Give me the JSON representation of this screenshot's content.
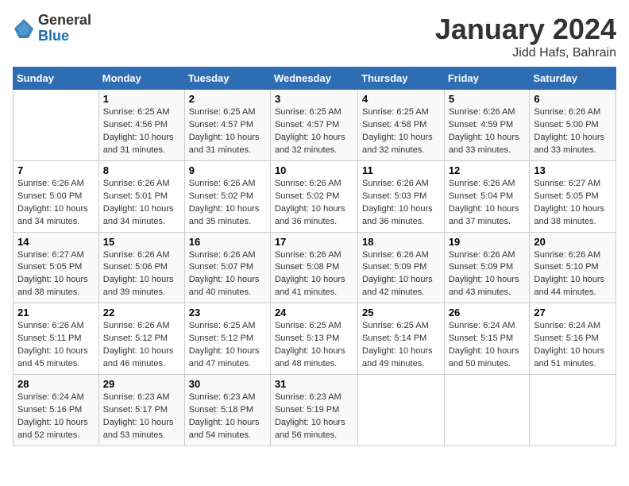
{
  "header": {
    "logo_general": "General",
    "logo_blue": "Blue",
    "title": "January 2024",
    "subtitle": "Jidd Hafs, Bahrain"
  },
  "days_of_week": [
    "Sunday",
    "Monday",
    "Tuesday",
    "Wednesday",
    "Thursday",
    "Friday",
    "Saturday"
  ],
  "weeks": [
    [
      {
        "num": "",
        "info": ""
      },
      {
        "num": "1",
        "info": "Sunrise: 6:25 AM\nSunset: 4:56 PM\nDaylight: 10 hours\nand 31 minutes."
      },
      {
        "num": "2",
        "info": "Sunrise: 6:25 AM\nSunset: 4:57 PM\nDaylight: 10 hours\nand 31 minutes."
      },
      {
        "num": "3",
        "info": "Sunrise: 6:25 AM\nSunset: 4:57 PM\nDaylight: 10 hours\nand 32 minutes."
      },
      {
        "num": "4",
        "info": "Sunrise: 6:25 AM\nSunset: 4:58 PM\nDaylight: 10 hours\nand 32 minutes."
      },
      {
        "num": "5",
        "info": "Sunrise: 6:26 AM\nSunset: 4:59 PM\nDaylight: 10 hours\nand 33 minutes."
      },
      {
        "num": "6",
        "info": "Sunrise: 6:26 AM\nSunset: 5:00 PM\nDaylight: 10 hours\nand 33 minutes."
      }
    ],
    [
      {
        "num": "7",
        "info": "Sunrise: 6:26 AM\nSunset: 5:00 PM\nDaylight: 10 hours\nand 34 minutes."
      },
      {
        "num": "8",
        "info": "Sunrise: 6:26 AM\nSunset: 5:01 PM\nDaylight: 10 hours\nand 34 minutes."
      },
      {
        "num": "9",
        "info": "Sunrise: 6:26 AM\nSunset: 5:02 PM\nDaylight: 10 hours\nand 35 minutes."
      },
      {
        "num": "10",
        "info": "Sunrise: 6:26 AM\nSunset: 5:02 PM\nDaylight: 10 hours\nand 36 minutes."
      },
      {
        "num": "11",
        "info": "Sunrise: 6:26 AM\nSunset: 5:03 PM\nDaylight: 10 hours\nand 36 minutes."
      },
      {
        "num": "12",
        "info": "Sunrise: 6:26 AM\nSunset: 5:04 PM\nDaylight: 10 hours\nand 37 minutes."
      },
      {
        "num": "13",
        "info": "Sunrise: 6:27 AM\nSunset: 5:05 PM\nDaylight: 10 hours\nand 38 minutes."
      }
    ],
    [
      {
        "num": "14",
        "info": "Sunrise: 6:27 AM\nSunset: 5:05 PM\nDaylight: 10 hours\nand 38 minutes."
      },
      {
        "num": "15",
        "info": "Sunrise: 6:26 AM\nSunset: 5:06 PM\nDaylight: 10 hours\nand 39 minutes."
      },
      {
        "num": "16",
        "info": "Sunrise: 6:26 AM\nSunset: 5:07 PM\nDaylight: 10 hours\nand 40 minutes."
      },
      {
        "num": "17",
        "info": "Sunrise: 6:26 AM\nSunset: 5:08 PM\nDaylight: 10 hours\nand 41 minutes."
      },
      {
        "num": "18",
        "info": "Sunrise: 6:26 AM\nSunset: 5:09 PM\nDaylight: 10 hours\nand 42 minutes."
      },
      {
        "num": "19",
        "info": "Sunrise: 6:26 AM\nSunset: 5:09 PM\nDaylight: 10 hours\nand 43 minutes."
      },
      {
        "num": "20",
        "info": "Sunrise: 6:26 AM\nSunset: 5:10 PM\nDaylight: 10 hours\nand 44 minutes."
      }
    ],
    [
      {
        "num": "21",
        "info": "Sunrise: 6:26 AM\nSunset: 5:11 PM\nDaylight: 10 hours\nand 45 minutes."
      },
      {
        "num": "22",
        "info": "Sunrise: 6:26 AM\nSunset: 5:12 PM\nDaylight: 10 hours\nand 46 minutes."
      },
      {
        "num": "23",
        "info": "Sunrise: 6:25 AM\nSunset: 5:12 PM\nDaylight: 10 hours\nand 47 minutes."
      },
      {
        "num": "24",
        "info": "Sunrise: 6:25 AM\nSunset: 5:13 PM\nDaylight: 10 hours\nand 48 minutes."
      },
      {
        "num": "25",
        "info": "Sunrise: 6:25 AM\nSunset: 5:14 PM\nDaylight: 10 hours\nand 49 minutes."
      },
      {
        "num": "26",
        "info": "Sunrise: 6:24 AM\nSunset: 5:15 PM\nDaylight: 10 hours\nand 50 minutes."
      },
      {
        "num": "27",
        "info": "Sunrise: 6:24 AM\nSunset: 5:16 PM\nDaylight: 10 hours\nand 51 minutes."
      }
    ],
    [
      {
        "num": "28",
        "info": "Sunrise: 6:24 AM\nSunset: 5:16 PM\nDaylight: 10 hours\nand 52 minutes."
      },
      {
        "num": "29",
        "info": "Sunrise: 6:23 AM\nSunset: 5:17 PM\nDaylight: 10 hours\nand 53 minutes."
      },
      {
        "num": "30",
        "info": "Sunrise: 6:23 AM\nSunset: 5:18 PM\nDaylight: 10 hours\nand 54 minutes."
      },
      {
        "num": "31",
        "info": "Sunrise: 6:23 AM\nSunset: 5:19 PM\nDaylight: 10 hours\nand 56 minutes."
      },
      {
        "num": "",
        "info": ""
      },
      {
        "num": "",
        "info": ""
      },
      {
        "num": "",
        "info": ""
      }
    ]
  ]
}
